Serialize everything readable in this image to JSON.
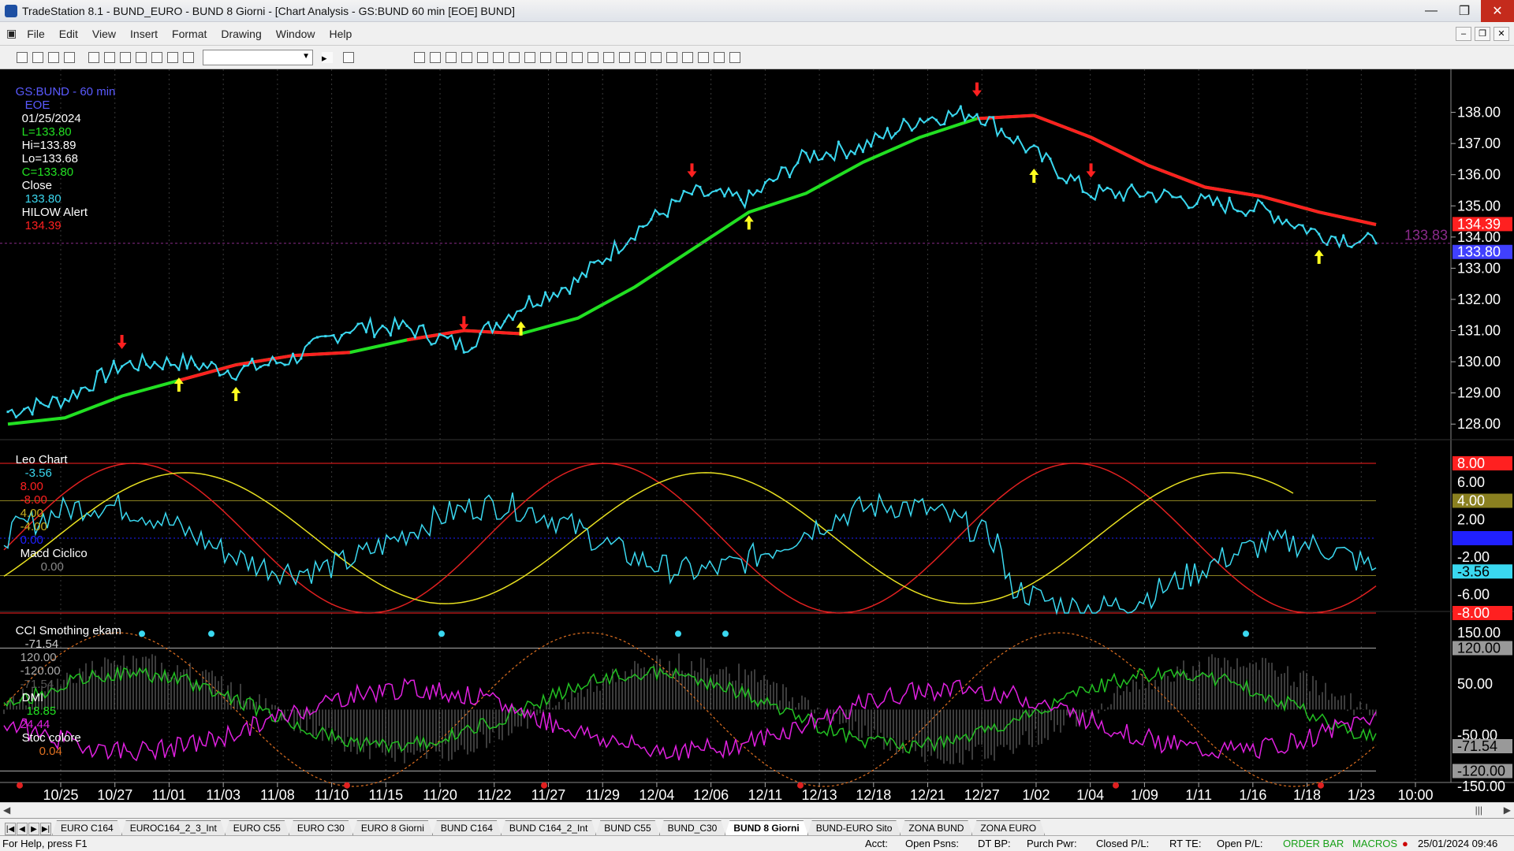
{
  "window": {
    "title": "TradeStation 8.1 - BUND_EURO - BUND 8 Giorni - [Chart Analysis - GS:BUND  60 min  [EOE] BUND]"
  },
  "menu": [
    "File",
    "Edit",
    "View",
    "Insert",
    "Format",
    "Drawing",
    "Window",
    "Help"
  ],
  "header": {
    "symbol": "GS:BUND - 60 min",
    "session": "EOE",
    "date": "01/25/2024",
    "last": "L=133.80",
    "high": "Hi=133.89",
    "low": "Lo=133.68",
    "close": "C=133.80",
    "close_label": "Close",
    "close_value": "133.80",
    "alert_label": "HILOW Alert",
    "alert_value": "134.39"
  },
  "price_axis": [
    "138.00",
    "137.00",
    "136.00",
    "135.00",
    "134.00",
    "133.00",
    "132.00",
    "131.00",
    "130.00",
    "129.00",
    "128.00"
  ],
  "price_markers": {
    "ma": "134.39",
    "last": "133.80",
    "cursor": "133.83"
  },
  "leo_panel": {
    "title": "Leo Chart",
    "values": [
      "-3.56",
      "8.00",
      "-8.00",
      "4.00",
      "-4.00",
      "0.00"
    ],
    "macd_label": "Macd Ciclico",
    "macd_value": "0.00",
    "axis": [
      "8.00",
      "6.00",
      "4.00",
      "2.00",
      "0.00",
      "-2.00",
      "-3.56",
      "-6.00",
      "-8.00"
    ]
  },
  "cci_panel": {
    "title": "CCI Smothing ekam",
    "values": [
      "-71.54",
      "120.00",
      "-120.00",
      "-71.54"
    ],
    "dmi_label": "DMI",
    "dmi_values": [
      "18.85",
      "24.44"
    ],
    "stoc_label": "Stoc colore",
    "stoc_value": "0.04",
    "axis": [
      "150.00",
      "120.00",
      "50.00",
      "-50.00",
      "-71.54",
      "-120.00",
      "-150.00"
    ]
  },
  "time_axis": [
    "10/25",
    "10/27",
    "11/01",
    "11/03",
    "11/08",
    "11/10",
    "11/15",
    "11/20",
    "11/22",
    "11/27",
    "11/29",
    "12/04",
    "12/06",
    "12/11",
    "12/13",
    "12/18",
    "12/21",
    "12/27",
    "1/02",
    "1/04",
    "1/09",
    "1/11",
    "1/16",
    "1/18",
    "1/23",
    "10:00"
  ],
  "chart_data": {
    "type": "line",
    "title": "GS:BUND - 60 min",
    "x": [
      "10/25",
      "10/27",
      "11/01",
      "11/03",
      "11/08",
      "11/10",
      "11/15",
      "11/20",
      "11/22",
      "11/27",
      "11/29",
      "12/04",
      "12/06",
      "12/11",
      "12/13",
      "12/18",
      "12/21",
      "12/27",
      "1/02",
      "1/04",
      "1/09",
      "1/11",
      "1/16",
      "1/18",
      "1/23"
    ],
    "ylim": [
      127.5,
      139
    ],
    "series": [
      {
        "name": "Close",
        "values": [
          128.4,
          128.8,
          129.9,
          130.0,
          129.7,
          130.1,
          131.1,
          131.1,
          130.5,
          131.8,
          132.6,
          134.2,
          135.4,
          135.2,
          136.6,
          136.9,
          137.8,
          138.0,
          136.7,
          135.4,
          135.4,
          135.1,
          134.9,
          134.1,
          133.8
        ]
      },
      {
        "name": "HILOW Alert",
        "values": [
          128.0,
          128.2,
          128.9,
          129.4,
          129.9,
          130.2,
          130.3,
          130.7,
          131.0,
          130.9,
          131.4,
          132.4,
          133.6,
          134.8,
          135.4,
          136.4,
          137.2,
          137.8,
          137.9,
          137.2,
          136.3,
          135.6,
          135.3,
          134.8,
          134.4
        ]
      }
    ]
  },
  "tabs": [
    "EURO C164",
    "EUROC164_2_3_Int",
    "EURO C55",
    "EURO C30",
    "EURO 8 Giorni",
    "BUND C164",
    "BUND C164_2_Int",
    "BUND C55",
    "BUND_C30",
    "BUND 8 Giorni",
    "BUND-EURO Sito",
    "ZONA BUND",
    "ZONA EURO"
  ],
  "active_tab": "BUND 8 Giorni",
  "status": {
    "help": "For Help, press F1",
    "acct": "Acct:",
    "open_psns": "Open Psns:",
    "dt_bp": "DT BP:",
    "purch_pwr": "Purch Pwr:",
    "closed_pl": "Closed P/L:",
    "rt_te": "RT TE:",
    "open_pl": "Open P/L:",
    "order_bar": "ORDER BAR",
    "macros": "MACROS",
    "datetime": "25/01/2024 09:46"
  },
  "colors": {
    "price": "#3ad8f0",
    "ma_up": "#22e022",
    "ma_down": "#ff2020",
    "leo_yellow": "#e8e020",
    "magenta": "#e020e0"
  }
}
